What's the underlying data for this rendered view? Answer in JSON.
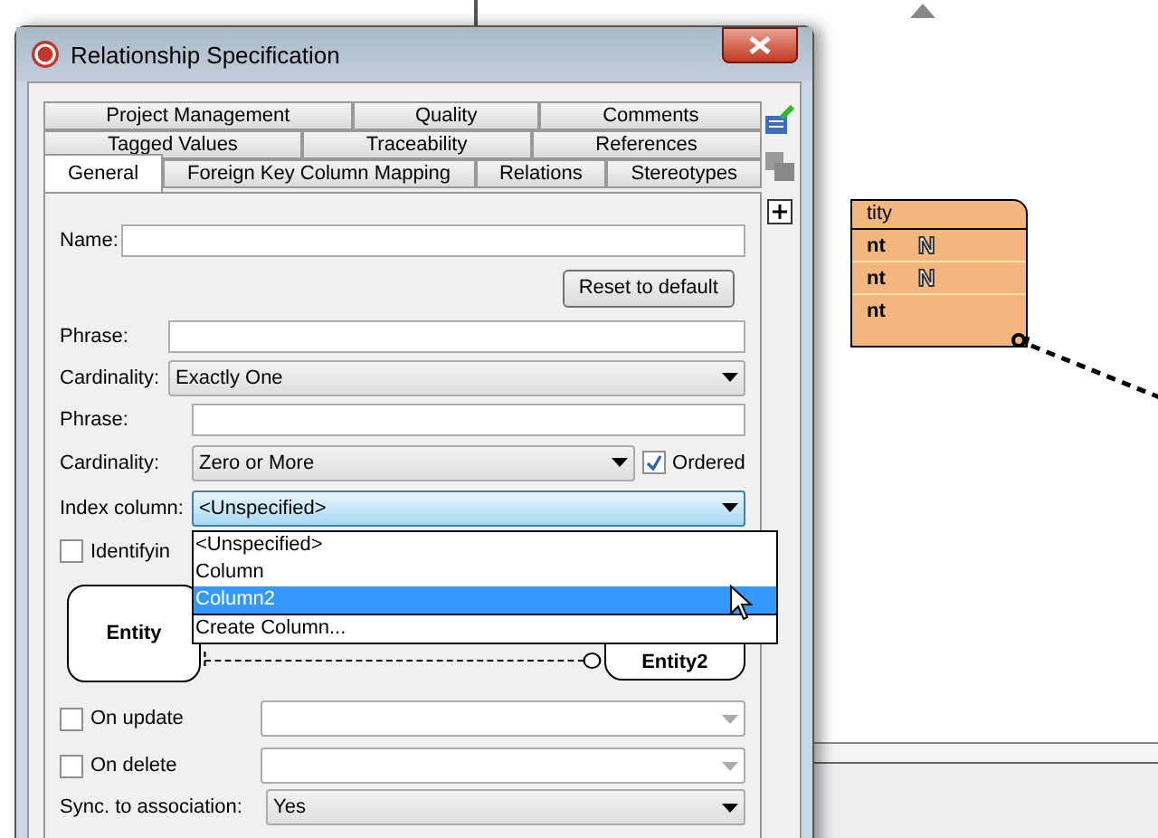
{
  "window": {
    "title": "Relationship Specification"
  },
  "tab_rows": [
    [
      {
        "label": "Project Management",
        "selected": false
      },
      {
        "label": "Quality",
        "selected": false
      },
      {
        "label": "Comments",
        "selected": false
      }
    ],
    [
      {
        "label": "Tagged Values",
        "selected": false
      },
      {
        "label": "Traceability",
        "selected": false
      },
      {
        "label": "References",
        "selected": false
      }
    ],
    [
      {
        "label": "General",
        "selected": true
      },
      {
        "label": "Foreign Key Column Mapping",
        "selected": false
      },
      {
        "label": "Relations",
        "selected": false
      },
      {
        "label": "Stereotypes",
        "selected": false
      }
    ]
  ],
  "form": {
    "name": {
      "label": "Name:"
    },
    "reset_button": "Reset to default",
    "from_end": {
      "phrase_label": "Phrase:",
      "cardinality_label": "Cardinality:",
      "cardinality": "Exactly One"
    },
    "to_end": {
      "phrase_label": "Phrase:",
      "cardinality_label": "Cardinality:",
      "cardinality": "Zero or More",
      "ordered": {
        "label": "Ordered",
        "checked": true
      }
    },
    "index_column": {
      "label": "Index column:",
      "value": "<Unspecified>",
      "expanded": true,
      "options": [
        {
          "label": "<Unspecified>",
          "highlighted": false
        },
        {
          "label": "Column",
          "highlighted": false
        },
        {
          "label": "Column2",
          "highlighted": true
        },
        {
          "label": "Create Column...",
          "highlighted": false
        }
      ]
    },
    "identifying": {
      "label": "Identifyin",
      "checked": false
    },
    "diagram": {
      "entities": [
        "Entity",
        "Entity2"
      ]
    },
    "on_update": {
      "label": "On update",
      "checked": false,
      "disabled": true
    },
    "on_delete": {
      "label": "On delete",
      "checked": false,
      "disabled": true
    },
    "sync": {
      "label": "Sync. to association:",
      "value": "Yes"
    }
  },
  "background_entity": {
    "title": "tity",
    "rows": [
      {
        "label": "nt",
        "badge": "N"
      },
      {
        "label": "nt",
        "badge": "N"
      },
      {
        "label": "nt"
      }
    ]
  }
}
